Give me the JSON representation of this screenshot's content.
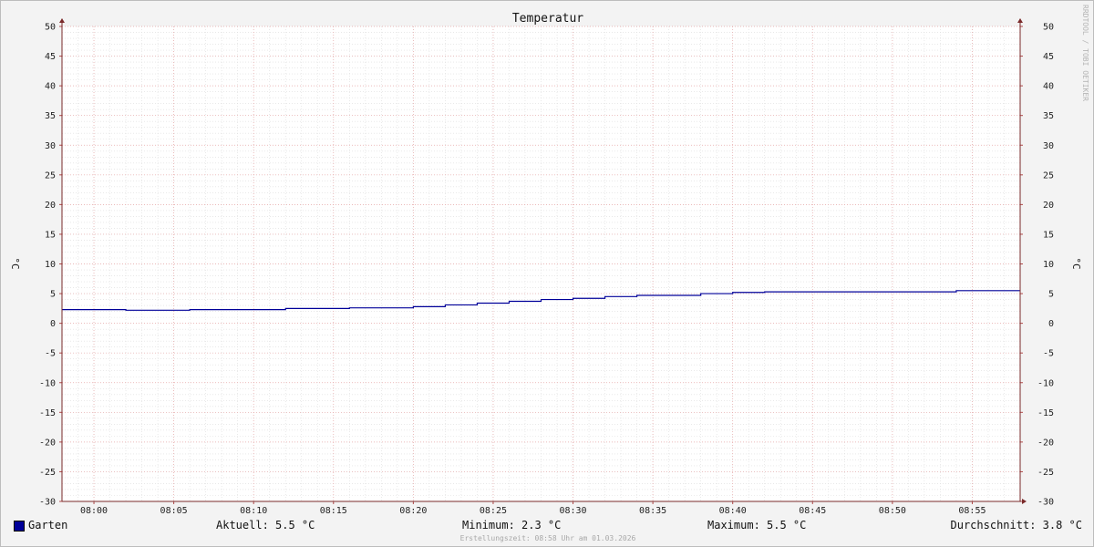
{
  "chart_data": {
    "type": "line",
    "title": "Temperatur",
    "ylabel": "°C",
    "xlabel": "",
    "ylim": [
      -30,
      50
    ],
    "yticks": [
      50,
      45,
      40,
      35,
      30,
      25,
      20,
      15,
      10,
      5,
      0,
      -5,
      -10,
      -15,
      -20,
      -25,
      -30
    ],
    "x_start": "07:58",
    "x_end": "08:58",
    "xticks": [
      "08:00",
      "08:05",
      "08:10",
      "08:15",
      "08:20",
      "08:25",
      "08:30",
      "08:35",
      "08:40",
      "08:45",
      "08:50",
      "08:55"
    ],
    "grid": true,
    "right_axis": true,
    "series": [
      {
        "name": "Garten",
        "color": "#000099",
        "step": true,
        "x": [
          "07:58",
          "08:02",
          "08:06",
          "08:12",
          "08:16",
          "08:20",
          "08:22",
          "08:24",
          "08:26",
          "08:28",
          "08:30",
          "08:32",
          "08:34",
          "08:38",
          "08:40",
          "08:42",
          "08:54",
          "08:58"
        ],
        "values": [
          2.3,
          2.2,
          2.3,
          2.5,
          2.6,
          2.8,
          3.1,
          3.4,
          3.7,
          4.0,
          4.2,
          4.5,
          4.7,
          5.0,
          5.2,
          5.3,
          5.5,
          5.5
        ]
      }
    ]
  },
  "legend": {
    "swatch_color": "#000099",
    "series_label": "Garten",
    "current": "Aktuell: 5.5 °C",
    "minimum": "Minimum: 2.3 °C",
    "maximum": "Maximum: 5.5 °C",
    "average": "Durchschnitt: 3.8 °C"
  },
  "watermark": "RRDTOOL / TOBI OETIKER",
  "footer": "Erstellungszeit: 08:58 Uhr am 01.03.2026"
}
